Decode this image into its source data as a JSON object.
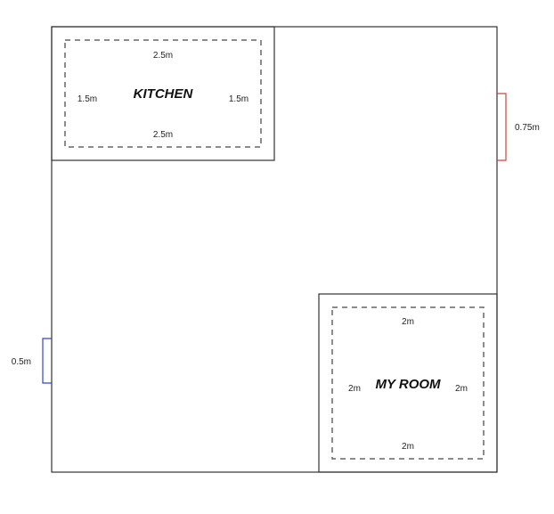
{
  "floor_plan": {
    "rooms": [
      {
        "name": "KITCHEN",
        "top_label": "2.5m",
        "bottom_label": "2.5m",
        "left_label": "1.5m",
        "right_label": "1.5m"
      },
      {
        "name": "MY ROOM",
        "top_label": "2m",
        "bottom_label": "2m",
        "left_label": "2m",
        "right_label": "2m"
      }
    ],
    "openings": [
      {
        "label": "0.75m",
        "color": "#cc4444"
      },
      {
        "label": "0.5m",
        "color": "#3344cc"
      }
    ],
    "colors": {
      "walls": "#333333",
      "dashed": "#666666"
    }
  }
}
